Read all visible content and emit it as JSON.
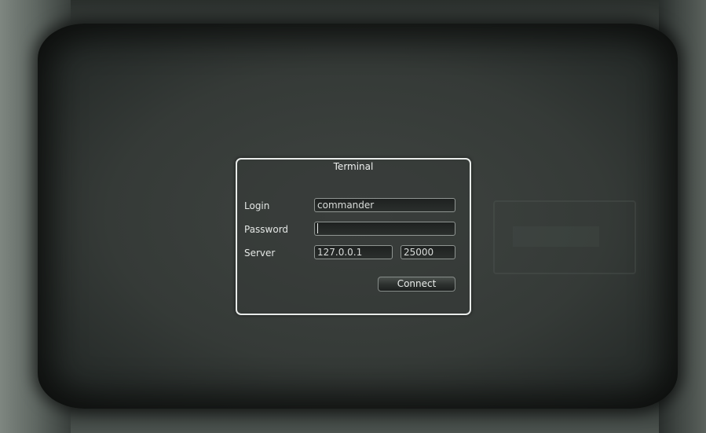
{
  "dialog": {
    "title": "Terminal",
    "login_label": "Login",
    "login_value": "commander",
    "password_label": "Password",
    "password_value": "",
    "server_label": "Server",
    "server_host_value": "127.0.0.1",
    "server_port_value": "25000",
    "connect_label": "Connect"
  },
  "colors": {
    "dialog_border": "#e8ebe9",
    "screen_background": "#353a37",
    "label_text": "#e4e7e5"
  }
}
